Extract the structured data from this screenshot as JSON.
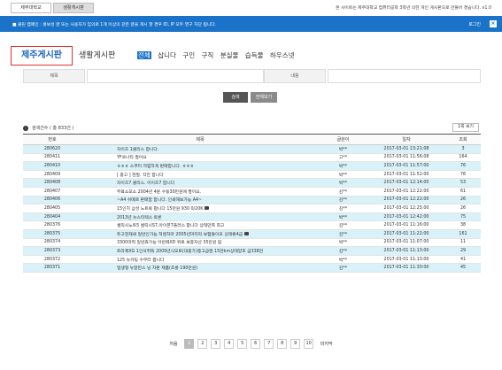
{
  "top": {
    "tabs": [
      "제주대학교",
      "생활게시판"
    ],
    "note": "본 사이트는 제주대학교 컴퓨터공학 3학년 의한 개인 게시판으로 만들어 졌습니다. v1.0"
  },
  "notice": {
    "text": "■ 클린 캠페인 : 홍보성 글 또는 사용자가 임의로 1개 이상의 같은 글을 게시 할 경우 ID, IP 모두 영구 차단 됩니다.",
    "login": "로그인",
    "close": "×"
  },
  "board": {
    "main": "제주게시판",
    "sub": "생활게시판",
    "categories": [
      "전체",
      "삽니다",
      "구인",
      "구직",
      "분실물",
      "습득물",
      "하우스넷"
    ]
  },
  "search": {
    "title_label": "제목",
    "content_label": "내용",
    "search_btn": "검색",
    "all_btn": "전체보기"
  },
  "list": {
    "count_text": "검색건수 ( 총 833건 )",
    "per_page": "1쪽 보기",
    "headers": [
      "번호",
      "제목",
      "글쓴이",
      "일자",
      "조회"
    ],
    "rows": [
      {
        "no": "280620",
        "title": "자이즈 1클리스 합니다.",
        "author": "박**",
        "date": "2017-03-01 13:21:08",
        "views": "3",
        "cam": false
      },
      {
        "no": "280411",
        "title": "YF쏘나타 팔아요",
        "author": "고**",
        "date": "2017-03-01 11:56:08",
        "views": "164",
        "cam": false
      },
      {
        "no": "280410",
        "title": "ㅎㅎㅎ 스쿠터 저렴하게 판매합니다. ㅎㅎㅎ",
        "author": "박**",
        "date": "2017-03-01 11:57:00",
        "views": "76",
        "cam": false
      },
      {
        "no": "280409",
        "title": "[ 중고 ] 현필. 작전 합니다",
        "author": "박**",
        "date": "2017-03-01 11:52:00",
        "views": "76",
        "cam": false
      },
      {
        "no": "280408",
        "title": "자이즈7 클리스. 이이즈7 합니다",
        "author": "박**",
        "date": "2017-03-01 12:14:00",
        "views": "53",
        "cam": false
      },
      {
        "no": "280407",
        "title": "무료소포소 2004년 4륜 수동30만원에 팔아요.",
        "author": "김**",
        "date": "2017-03-01 12:22:00",
        "views": "61",
        "cam": false
      },
      {
        "no": "280406",
        "title": "~A4 쉬메르 판매합 합니다. 인쇄해보가능 A4~",
        "author": "김**",
        "date": "2017-03-01 12:22:00",
        "views": "26",
        "cam": false
      },
      {
        "no": "280405",
        "title": "15인치 삼성 노트북 팝니다 15만원 930 0/20K",
        "author": "김**",
        "date": "2017-03-01 12:25:00",
        "views": "26",
        "cam": true
      },
      {
        "no": "280404",
        "title": "2013년 뉴스타텍스 토론",
        "author": "박**",
        "date": "2017-03-01 12:42:00",
        "views": "75",
        "cam": false
      },
      {
        "no": "280376",
        "title": "셀릭시노트5 셀릭시S7,아이폰7플러스 팝니다 상태만족 최고",
        "author": "김**",
        "date": "2017-03-01 11:16:00",
        "views": "38",
        "cam": false
      },
      {
        "no": "280375",
        "title": "듀고현재쇄 일반인가능 적렌처마 2005년마지막 보험들이오 상태좋4급",
        "author": "김**",
        "date": "2017-03-01 11:22:00",
        "views": "161",
        "cam": true
      },
      {
        "no": "280374",
        "title": "3300마력 일반효가능 아반떼XD 위로 보증자산 35만원 팜",
        "author": "박**",
        "date": "2017-03-01 11:07:00",
        "views": "11",
        "cam": false
      },
      {
        "no": "280373",
        "title": "트라제XG 1인석취득 2009년식오토(대출가)중고급렌 15만km상태양호 급338만",
        "author": "김**",
        "date": "2017-03-01 11:13:00",
        "views": "29",
        "cam": false
      },
      {
        "no": "280372",
        "title": "125 뉴카팅 수무터 팝니다",
        "author": "박**",
        "date": "2017-03-01 11:13:00",
        "views": "41",
        "cam": false
      },
      {
        "no": "280371",
        "title": "일생형 뉴알만스 닝 차판 제품(초롱 190만원)",
        "author": "김**",
        "date": "2017-03-01 11:30:00",
        "views": "45",
        "cam": false
      }
    ]
  },
  "pager": {
    "first": "처음",
    "last": "마지막",
    "pages": [
      "1",
      "2",
      "3",
      "4",
      "5",
      "6",
      "7",
      "8",
      "9",
      "10"
    ],
    "current": "1"
  }
}
